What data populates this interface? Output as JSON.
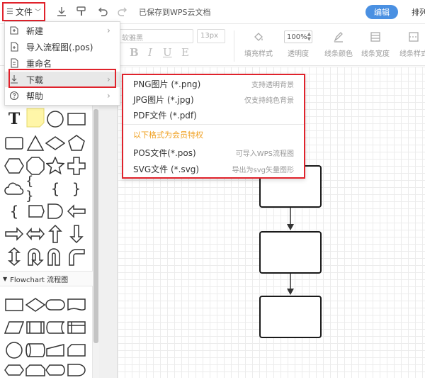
{
  "toolbar": {
    "file_label": "文件",
    "save_status": "已保存到WPS云文档",
    "edit_button": "编辑",
    "arrange_label": "排列"
  },
  "format": {
    "font_placeholder": "软雅黑",
    "size_placeholder": "13px",
    "bold": "B",
    "italic": "I",
    "underline": "U",
    "strike": "E",
    "fill_label": "填充样式",
    "opacity_value": "100%",
    "opacity_label": "透明度",
    "line_color_label": "线条颜色",
    "line_width_label": "线条宽度",
    "line_style_label": "线条样式"
  },
  "left_panel": {
    "flowchart_section": "Flowchart 流程图"
  },
  "file_menu": {
    "items": [
      {
        "label": "新建",
        "icon": "new-file-icon",
        "has_submenu": true
      },
      {
        "label": "导入流程图(.pos)",
        "icon": "import-icon",
        "has_submenu": false
      },
      {
        "label": "重命名",
        "icon": "rename-icon",
        "has_submenu": false
      },
      {
        "label": "下载",
        "icon": "download-icon",
        "has_submenu": true
      },
      {
        "label": "帮助",
        "icon": "help-icon",
        "has_submenu": true
      }
    ]
  },
  "download_menu": {
    "items": [
      {
        "name": "PNG图片 (*.png)",
        "desc": "支持透明背景"
      },
      {
        "name": "JPG图片 (*.jpg)",
        "desc": "仅支持纯色背景"
      },
      {
        "name": "PDF文件 (*.pdf)",
        "desc": ""
      }
    ],
    "member_note": "以下格式为会员特权",
    "member_items": [
      {
        "name": "POS文件(*.pos)",
        "desc": "可导入WPS流程图"
      },
      {
        "name": "SVG文件 (*.svg)",
        "desc": "导出为svg矢量图形"
      }
    ]
  },
  "colors": {
    "accent": "#4a90e2",
    "highlight_border": "#e0222b",
    "member_note": "#f0a020"
  }
}
